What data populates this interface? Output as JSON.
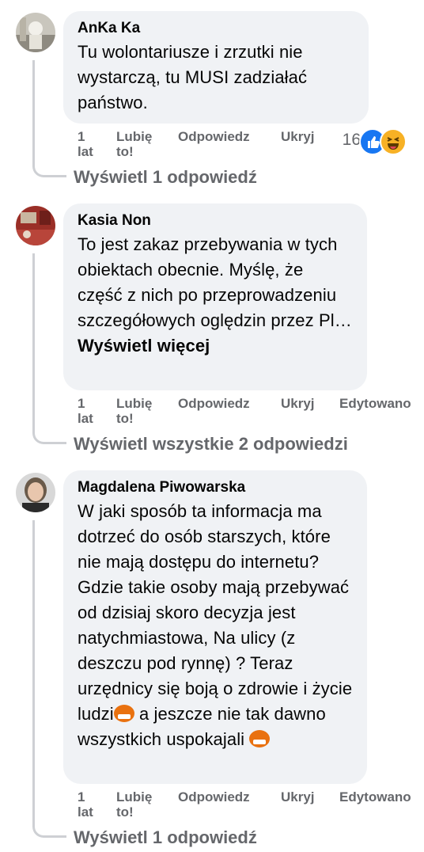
{
  "comments": [
    {
      "author": "AnKa Ka",
      "text": "Tu wolontariusze i zrzutki nie wystarczą, tu MUSI zadziałać państwo.",
      "actions": {
        "time_line1": "1",
        "time_line2": "lat",
        "like_line1": "Lubię",
        "like_line2": "to!",
        "reply": "Odpowiedz",
        "hide": "Ukryj"
      },
      "reactions": {
        "count": "16",
        "types": [
          "like-icon",
          "haha-icon"
        ]
      },
      "view_replies": "Wyświetl 1 odpowiedź"
    },
    {
      "author": "Kasia Non",
      "text": "To jest zakaz przebywania w tych obiektach obecnie. Myślę, że część z nich po przeprowadzeniu szczegółowych oględzin przez Pl…",
      "see_more": "Wyświetl więcej",
      "actions": {
        "time_line1": "1",
        "time_line2": "lat",
        "like_line1": "Lubię",
        "like_line2": "to!",
        "reply": "Odpowiedz",
        "hide": "Ukryj",
        "edited": "Edytowano"
      },
      "view_replies": "Wyświetl wszystkie 2 odpowiedzi"
    },
    {
      "author": "Magdalena Piwowarska",
      "text_part1": "W jaki sposób ta informacja ma dotrzeć do osób starszych, które nie mają dostępu do internetu? Gdzie takie osoby mają przebywać od dzisiaj skoro decyzja jest natychmiastowa, Na ulicy (z deszczu pod rynnę) ? Teraz urzędnicy się boją o zdrowie i życie ludzi",
      "text_part2": " a jeszcze nie tak dawno wszystkich uspokajali ",
      "emoji": "angry-cursing-face-icon",
      "actions": {
        "time_line1": "1",
        "time_line2": "lat",
        "like_line1": "Lubię",
        "like_line2": "to!",
        "reply": "Odpowiedz",
        "hide": "Ukryj",
        "edited": "Edytowano"
      },
      "view_replies": "Wyświetl 1 odpowiedź"
    }
  ],
  "colors": {
    "bubble": "#f0f2f5",
    "secondary_text": "#65676b",
    "like_blue": "#1877f2",
    "haha_yellow": "#f7b125"
  }
}
